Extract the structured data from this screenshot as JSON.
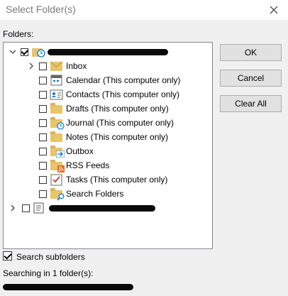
{
  "window": {
    "title": "Select Folder(s)"
  },
  "labels": {
    "folders": "Folders:",
    "search_subfolders": "Search subfolders",
    "searching_in": "Searching in 1 folder(s):"
  },
  "buttons": {
    "ok": "OK",
    "cancel": "Cancel",
    "clear_all": "Clear All"
  },
  "tree": {
    "items": [
      {
        "label": "Inbox"
      },
      {
        "label": "Calendar (This computer only)"
      },
      {
        "label": "Contacts (This computer only)"
      },
      {
        "label": "Drafts (This computer only)"
      },
      {
        "label": "Journal (This computer only)"
      },
      {
        "label": "Notes (This computer only)"
      },
      {
        "label": "Outbox"
      },
      {
        "label": "RSS Feeds"
      },
      {
        "label": "Tasks (This computer only)"
      },
      {
        "label": "Search Folders"
      }
    ]
  },
  "colors": {
    "folder": "#e8c46a",
    "accent": "#0078d7",
    "rss": "#e06b1b"
  }
}
